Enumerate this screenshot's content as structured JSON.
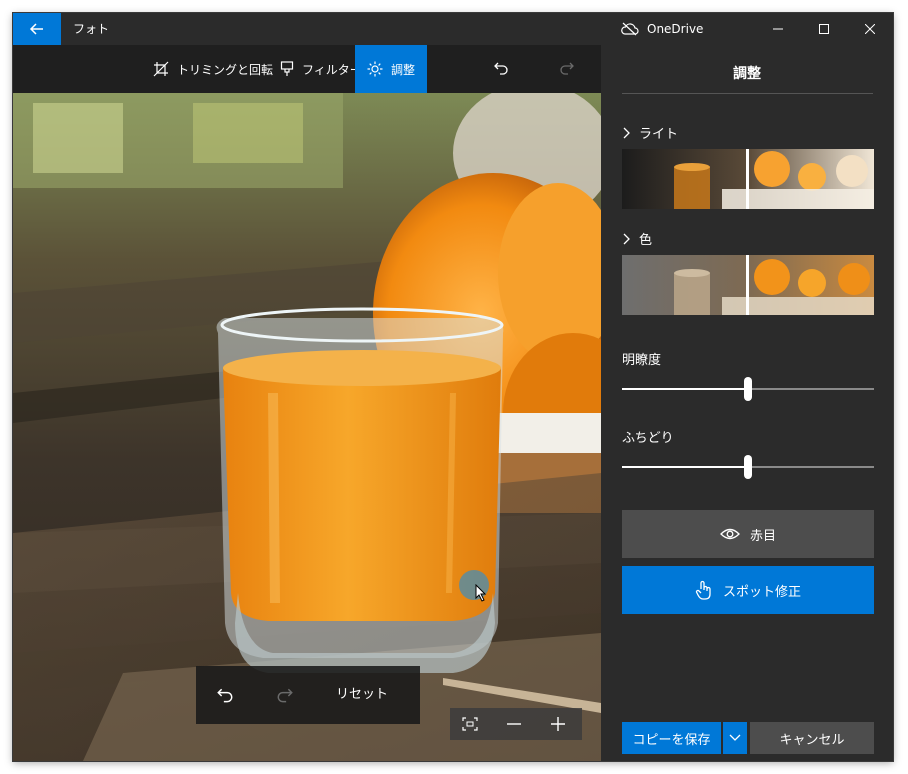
{
  "window": {
    "app_title": "フォト",
    "onedrive_label": "OneDrive"
  },
  "toolbar": {
    "crop_label": "トリミングと回転",
    "filter_label": "フィルター",
    "adjust_label": "調整"
  },
  "panel": {
    "title": "調整",
    "light_label": "ライト",
    "color_label": "色",
    "clarity_label": "明瞭度",
    "vignette_label": "ふちどり",
    "clarity_value": 0.5,
    "vignette_value": 0.5,
    "red_eye_label": "赤目",
    "spot_fix_label": "スポット修正",
    "save_copy_label": "コピーを保存",
    "cancel_label": "キャンセル"
  },
  "photo_controls": {
    "reset_label": "リセット"
  },
  "colors": {
    "accent": "#0078d7",
    "panel_bg": "#2b2b2b",
    "toolbar_bg": "#1f1f1f",
    "button_gray": "#4d4d4d"
  },
  "icons": {
    "back": "arrow-left-icon",
    "onedrive": "cloud-off-icon",
    "minimize": "minimize-icon",
    "maximize": "maximize-icon",
    "close": "close-icon",
    "crop": "crop-icon",
    "filter": "brush-icon",
    "adjust": "sun-icon",
    "undo": "undo-icon",
    "redo": "redo-icon",
    "red_eye": "eye-icon",
    "spot_fix": "touch-hand-icon",
    "fit": "fit-screen-icon",
    "zoom_out": "minus-icon",
    "zoom_in": "plus-icon"
  }
}
